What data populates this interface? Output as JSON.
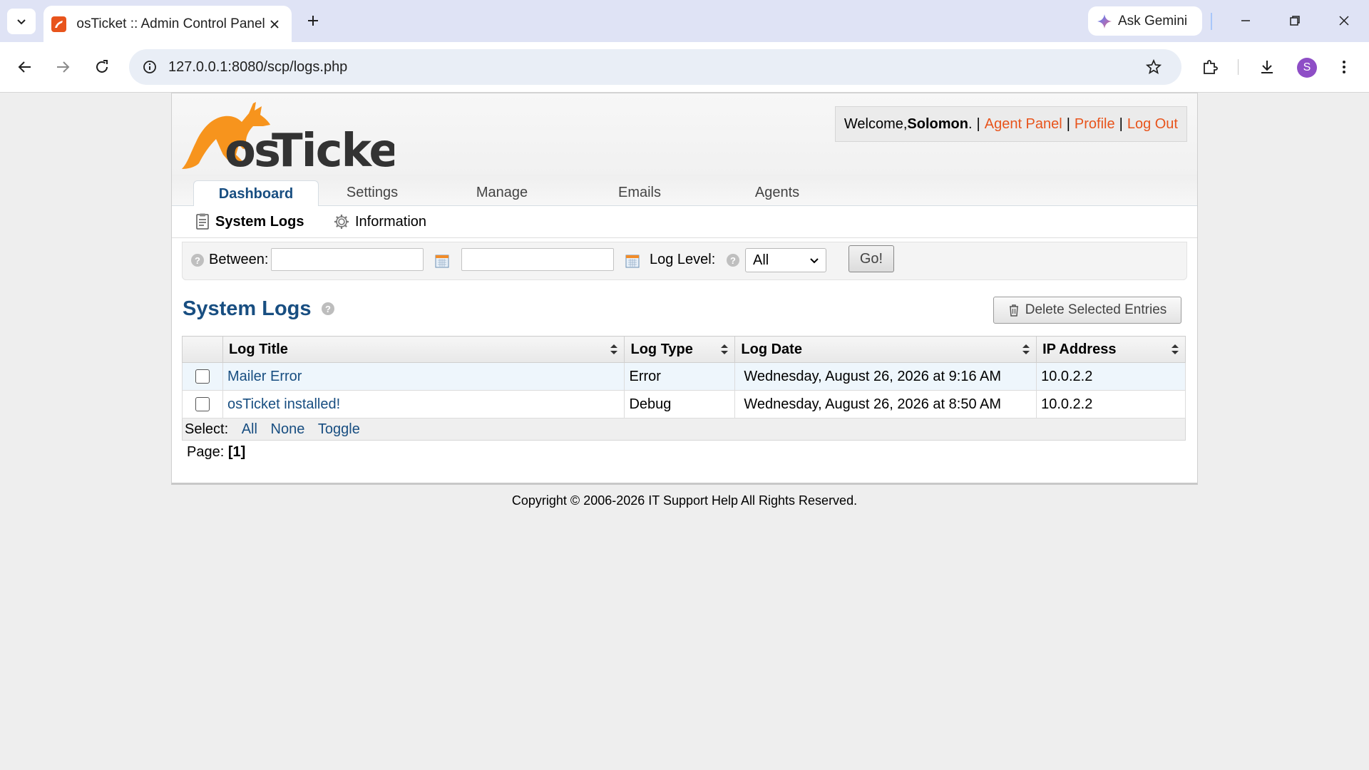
{
  "browser": {
    "tab_title": "osTicket :: Admin Control Panel",
    "url": "127.0.0.1:8080/scp/logs.php",
    "gemini_label": "Ask Gemini",
    "avatar_letter": "S"
  },
  "header": {
    "welcome_prefix": "Welcome, ",
    "username": "Solomon",
    "welcome_suffix": ".",
    "sep": "|",
    "agent_panel": "Agent Panel",
    "profile": "Profile",
    "logout": "Log Out"
  },
  "nav": {
    "tabs": [
      "Dashboard",
      "Settings",
      "Manage",
      "Emails",
      "Agents"
    ],
    "active": "Dashboard"
  },
  "subnav": {
    "system_logs": "System Logs",
    "information": "Information"
  },
  "filter": {
    "between_label": "Between:",
    "from_value": "",
    "to_value": "",
    "log_level_label": "Log Level:",
    "log_level_value": "All",
    "go_label": "Go!"
  },
  "main": {
    "title": "System Logs",
    "help_glyph": "?",
    "delete_button": "Delete Selected Entries"
  },
  "table": {
    "headers": [
      "Log Title",
      "Log Type",
      "Log Date",
      "IP Address"
    ],
    "rows": [
      {
        "title": "Mailer Error",
        "type": "Error",
        "date": "Wednesday, August 26, 2026 at 9:16 AM",
        "ip": "10.0.2.2"
      },
      {
        "title": "osTicket installed!",
        "type": "Debug",
        "date": "Wednesday, August 26, 2026 at 8:50 AM",
        "ip": "10.0.2.2"
      }
    ],
    "select_label": "Select:",
    "select_all": "All",
    "select_none": "None",
    "select_toggle": "Toggle"
  },
  "pager": {
    "label": "Page:",
    "current": "[1]"
  },
  "footer": {
    "copyright": "Copyright © 2006-2026 IT Support Help All Rights Reserved."
  },
  "colors": {
    "brand_orange": "#e8541c",
    "link_blue": "#184e81"
  }
}
